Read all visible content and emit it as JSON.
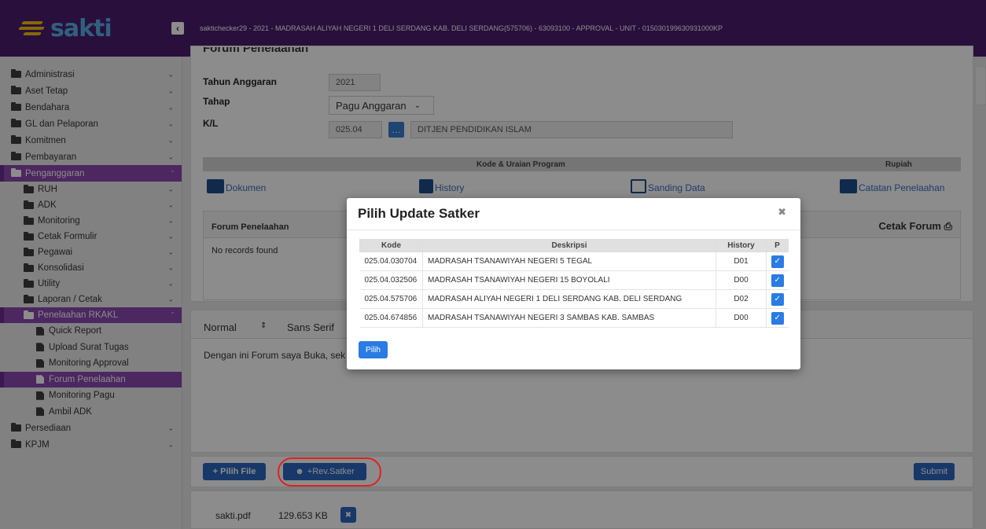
{
  "topbar": {
    "logo": "sakti",
    "info": "saktichecker29 - 2021 - MADRASAH ALIYAH NEGERI 1 DELI SERDANG KAB. DELI SERDANG(575706) - 63093100 - APPROVAL - UNIT - 015030199630931000KP"
  },
  "sidebar": {
    "items": [
      {
        "label": "Administrasi"
      },
      {
        "label": "Aset Tetap"
      },
      {
        "label": "Bendahara"
      },
      {
        "label": "GL dan Pelaporan"
      },
      {
        "label": "Komitmen"
      },
      {
        "label": "Pembayaran"
      },
      {
        "label": "Penganggaran"
      },
      {
        "label": "RUH"
      },
      {
        "label": "ADK"
      },
      {
        "label": "Monitoring"
      },
      {
        "label": "Cetak Formulir"
      },
      {
        "label": "Pegawai"
      },
      {
        "label": "Konsolidasi"
      },
      {
        "label": "Utility"
      },
      {
        "label": "Laporan / Cetak"
      },
      {
        "label": "Penelaahan RKAKL"
      },
      {
        "label": "Quick Report"
      },
      {
        "label": "Upload Surat Tugas"
      },
      {
        "label": "Monitoring Approval"
      },
      {
        "label": "Forum Penelaahan"
      },
      {
        "label": "Monitoring Pagu"
      },
      {
        "label": "Ambil ADK"
      },
      {
        "label": "Persediaan"
      },
      {
        "label": "KPJM"
      }
    ]
  },
  "form": {
    "header": "Forum Penelaahan",
    "tahun_label": "Tahun Anggaran",
    "tahun_value": "2021",
    "tahap_label": "Tahap",
    "tahap_value": "Pagu Anggaran",
    "kl_label": "K/L",
    "kl_code": "025.04",
    "kl_name": "DITJEN PENDIDIKAN ISLAM"
  },
  "program_table": {
    "col_program": "Kode & Uraian Program",
    "col_rupiah": "Rupiah"
  },
  "toolbar": {
    "dokumen": "Dokumen",
    "history": "History",
    "sanding": "Sanding Data",
    "catatan": "Catatan Penelaahan"
  },
  "forum": {
    "title": "Forum Penelaahan",
    "empty": "No records found",
    "cetak": "Cetak Forum"
  },
  "editor": {
    "format": "Normal",
    "font": "Sans Serif",
    "content": "Dengan ini Forum saya Buka, sek"
  },
  "actions": {
    "pilih_file": "+ Pilih File",
    "rev_satker": "+Rev.Satker",
    "submit": "Submit"
  },
  "file": {
    "name": "sakti.pdf",
    "size": "129.653 KB"
  },
  "modal": {
    "title": "Pilih Update Satker",
    "columns": {
      "kode": "Kode",
      "deskripsi": "Deskripsi",
      "history": "History",
      "p": "P"
    },
    "rows": [
      {
        "kode": "025.04.030704",
        "deskripsi": "MADRASAH TSANAWIYAH NEGERI 5 TEGAL",
        "history": "D01"
      },
      {
        "kode": "025.04.032506",
        "deskripsi": "MADRASAH TSANAWIYAH NEGERI 15 BOYOLALI",
        "history": "D00"
      },
      {
        "kode": "025.04.575706",
        "deskripsi": "MADRASAH ALIYAH NEGERI 1 DELI SERDANG KAB. DELI SERDANG",
        "history": "D02"
      },
      {
        "kode": "025.04.674856",
        "deskripsi": "MADRASAH TSANAWIYAH NEGERI 3 SAMBAS KAB. SAMBAS",
        "history": "D00"
      }
    ],
    "pilih": "Pilih"
  },
  "colors": {
    "topbar": "#4a1d6e",
    "active": "#8a48b0",
    "primary": "#2a66c0",
    "highlight": "#e02020"
  }
}
